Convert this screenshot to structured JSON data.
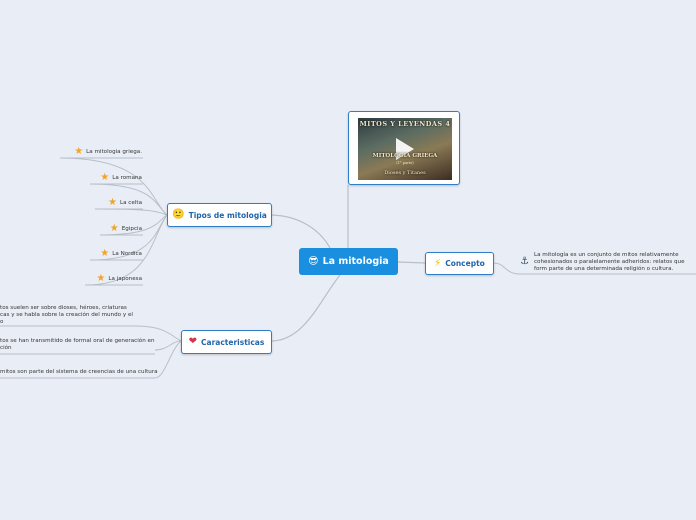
{
  "central": {
    "label": "La mitologia",
    "icon": "sunglasses-smiley-icon"
  },
  "branches": {
    "tipos": {
      "label": "Tipos de mitologia",
      "icon": "smiley-icon",
      "items": [
        "La mitologia griega.",
        "La romana",
        "La celta",
        "Egipcia",
        "La Nordica",
        "La japonesa"
      ],
      "item_icon": "star-icon"
    },
    "caracteristicas": {
      "label": "Caracteristicas",
      "icon": "heart-icon",
      "items": [
        "tos suelen ser sobre dioses, héroes, criaturas cas y se habla sobre la creación del mundo y el o",
        "tos se han transmitido de formal oral de generación en ción",
        "mitos son parte del sistema de creencias de una cultura"
      ]
    },
    "concepto": {
      "label": "Concepto",
      "icon": "lightning-icon",
      "detail_icon": "anchor-icon",
      "detail": "La mitología es un conjunto de mitos relativamente cohesionados o paralelamente adheridos: relatos que form parte de una determinada religión o cultura."
    },
    "video": {
      "title": "MITOS Y LEYENDAS 4",
      "subtitle": "MITOLOGIA GRIEGA",
      "part": "(1° parte)",
      "caption": "Dioses y Titanes",
      "icon": "play-icon"
    }
  },
  "colors": {
    "background": "#e9eef6",
    "central": "#1a8fe0",
    "node_border": "#2f7fc8",
    "link": "#b7bfca",
    "star": "#f4a326"
  }
}
